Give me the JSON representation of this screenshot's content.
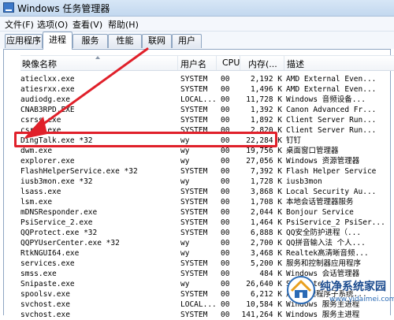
{
  "window": {
    "title": "Windows 任务管理器"
  },
  "menu": [
    "文件(F)",
    "选项(O)",
    "查看(V)",
    "帮助(H)"
  ],
  "tabs": [
    "应用程序",
    "进程",
    "服务",
    "性能",
    "联网",
    "用户"
  ],
  "active_tab": "进程",
  "columns": {
    "name": "映像名称",
    "user": "用户名",
    "cpu": "CPU",
    "mem": "内存(...",
    "desc": "描述"
  },
  "rows": [
    {
      "name": "atieclxx.exe",
      "user": "SYSTEM",
      "cpu": "00",
      "mem": "2,192 K",
      "desc": "AMD External Even..."
    },
    {
      "name": "atiesrxx.exe",
      "user": "SYSTEM",
      "cpu": "00",
      "mem": "1,496 K",
      "desc": "AMD External Even..."
    },
    {
      "name": "audiodg.exe",
      "user": "LOCAL...",
      "cpu": "00",
      "mem": "11,728 K",
      "desc": "Windows 音频设备..."
    },
    {
      "name": "CNAB3RPD.EXE",
      "user": "SYSTEM",
      "cpu": "00",
      "mem": "1,392 K",
      "desc": "Canon Advanced Fr..."
    },
    {
      "name": "csrss.exe",
      "user": "SYSTEM",
      "cpu": "00",
      "mem": "1,892 K",
      "desc": "Client Server Run..."
    },
    {
      "name": "csrss.exe",
      "user": "SYSTEM",
      "cpu": "00",
      "mem": "2,820 K",
      "desc": "Client Server Run..."
    },
    {
      "name": "DingTalk.exe *32",
      "user": "wy",
      "cpu": "00",
      "mem": "22,284 K",
      "desc": "钉钉"
    },
    {
      "name": "dwm.exe",
      "user": "wy",
      "cpu": "00",
      "mem": "19,756 K",
      "desc": "桌面窗口管理器"
    },
    {
      "name": "explorer.exe",
      "user": "wy",
      "cpu": "00",
      "mem": "27,056 K",
      "desc": "Windows 资源管理器"
    },
    {
      "name": "FlashHelperService.exe *32",
      "user": "SYSTEM",
      "cpu": "00",
      "mem": "7,392 K",
      "desc": "Flash Helper Service"
    },
    {
      "name": "iusb3mon.exe *32",
      "user": "wy",
      "cpu": "00",
      "mem": "1,728 K",
      "desc": "iusb3mon"
    },
    {
      "name": "lsass.exe",
      "user": "SYSTEM",
      "cpu": "00",
      "mem": "3,868 K",
      "desc": "Local Security Au..."
    },
    {
      "name": "lsm.exe",
      "user": "SYSTEM",
      "cpu": "00",
      "mem": "1,708 K",
      "desc": "本地会话管理器服务"
    },
    {
      "name": "mDNSResponder.exe",
      "user": "SYSTEM",
      "cpu": "00",
      "mem": "2,044 K",
      "desc": "Bonjour Service"
    },
    {
      "name": "PsiService_2.exe",
      "user": "SYSTEM",
      "cpu": "00",
      "mem": "1,464 K",
      "desc": "PsiService_2 PsiSer..."
    },
    {
      "name": "QQProtect.exe *32",
      "user": "SYSTEM",
      "cpu": "00",
      "mem": "6,888 K",
      "desc": "QQ安全防护进程（..."
    },
    {
      "name": "QQPYUserCenter.exe *32",
      "user": "wy",
      "cpu": "00",
      "mem": "2,700 K",
      "desc": "QQ拼音输入法 个人..."
    },
    {
      "name": "RtkNGUI64.exe",
      "user": "wy",
      "cpu": "00",
      "mem": "3,468 K",
      "desc": "Realtek高清晰音频..."
    },
    {
      "name": "services.exe",
      "user": "SYSTEM",
      "cpu": "00",
      "mem": "5,200 K",
      "desc": "服务和控制器应用程序"
    },
    {
      "name": "smss.exe",
      "user": "SYSTEM",
      "cpu": "00",
      "mem": "484 K",
      "desc": "Windows 会话管理器"
    },
    {
      "name": "Snipaste.exe",
      "user": "wy",
      "cpu": "00",
      "mem": "26,640 K",
      "desc": "Snipaste"
    },
    {
      "name": "spoolsv.exe",
      "user": "SYSTEM",
      "cpu": "00",
      "mem": "6,212 K",
      "desc": "后台处理程序子系统..."
    },
    {
      "name": "svchost.exe",
      "user": "LOCAL...",
      "cpu": "00",
      "mem": "10,584 K",
      "desc": "Windows 服务主进程"
    },
    {
      "name": "svchost.exe",
      "user": "SYSTEM",
      "cpu": "00",
      "mem": "141,264 K",
      "desc": "Windows 服务主进程"
    }
  ],
  "highlighted_row": "DingTalk.exe *32",
  "watermark": {
    "name": "纯净系统家园",
    "url": "www.yidaimei.com"
  },
  "colors": {
    "highlight": "#e0202a",
    "arrow": "#e0202a",
    "accent": "#1a4a8e"
  }
}
